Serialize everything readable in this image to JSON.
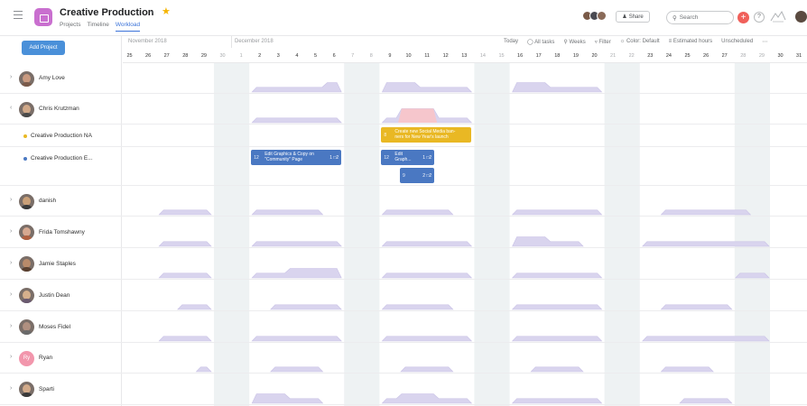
{
  "header": {
    "title": "Creative Production",
    "tabs": [
      {
        "label": "Projects",
        "active": false
      },
      {
        "label": "Timeline",
        "active": false
      },
      {
        "label": "Workload",
        "active": true
      }
    ],
    "share_label": "Share",
    "search_placeholder": "Search",
    "plus_label": "+",
    "help_label": "?"
  },
  "left": {
    "add_project_label": "Add Project"
  },
  "timeline": {
    "months": [
      "November 2018",
      "December 2018"
    ],
    "toolbar": [
      "Today",
      "All tasks",
      "Weeks",
      "Filter",
      "Color: Default",
      "Estimated hours",
      "Unscheduled",
      "⋯"
    ],
    "days": [
      "25",
      "26",
      "27",
      "28",
      "29",
      "30",
      "1",
      "2",
      "3",
      "4",
      "5",
      "6",
      "7",
      "8",
      "9",
      "10",
      "11",
      "12",
      "13",
      "14",
      "15",
      "16",
      "17",
      "18",
      "19",
      "20",
      "21",
      "22",
      "23",
      "24",
      "25",
      "26",
      "27",
      "28",
      "29",
      "30",
      "31"
    ],
    "weekend_indices": [
      5,
      6,
      12,
      13,
      19,
      20,
      26,
      27,
      33,
      34
    ]
  },
  "rows": [
    {
      "name": "Amy Love",
      "expander": "›",
      "type": "person",
      "skin": "#c99a80",
      "shirt": "#7a5a4a",
      "load": [
        0,
        0,
        0,
        0,
        0,
        0,
        0,
        1,
        1,
        1,
        1,
        2,
        0,
        0,
        2,
        2,
        1,
        1,
        1,
        0,
        0,
        2,
        2,
        1,
        1,
        1,
        0,
        0,
        0,
        0,
        0,
        0,
        0,
        0,
        0,
        0,
        0
      ]
    },
    {
      "name": "Chris Krutzman",
      "expander": "‹",
      "type": "person",
      "skin": "#d0a888",
      "shirt": "#4a4a4a",
      "load": [
        0,
        0,
        0,
        0,
        0,
        0,
        0,
        1,
        1,
        1,
        1,
        1,
        0,
        0,
        1,
        3,
        3,
        1,
        1,
        0,
        0,
        0,
        0,
        0,
        0,
        0,
        0,
        0,
        0,
        0,
        0,
        0,
        0,
        0,
        0,
        0,
        0
      ],
      "over": [
        15,
        16
      ]
    },
    {
      "name": "Creative Production NA",
      "type": "project",
      "dot": "#e9b824"
    },
    {
      "name": "Creative Production E...",
      "type": "project",
      "dot": "#4a78c2"
    },
    {
      "name": "danish",
      "expander": "›",
      "type": "person",
      "skin": "#caa078",
      "shirt": "#3a3a3a",
      "load": [
        0,
        0,
        1,
        1,
        1,
        0,
        0,
        1,
        1,
        1,
        1,
        0,
        0,
        0,
        1,
        1,
        1,
        1,
        0,
        0,
        0,
        1,
        1,
        1,
        1,
        1,
        0,
        0,
        0,
        1,
        1,
        1,
        1,
        1,
        0,
        0,
        0
      ]
    },
    {
      "name": "Frida Tomshawny",
      "expander": "›",
      "type": "person",
      "skin": "#d6a890",
      "shirt": "#b06040",
      "load": [
        0,
        0,
        1,
        1,
        1,
        0,
        0,
        1,
        1,
        1,
        1,
        1,
        0,
        0,
        1,
        1,
        1,
        1,
        1,
        0,
        0,
        2,
        2,
        1,
        1,
        0,
        0,
        0,
        1,
        1,
        1,
        1,
        1,
        1,
        1,
        0,
        0
      ]
    },
    {
      "name": "Jamie Staples",
      "expander": "›",
      "type": "person",
      "skin": "#b88a6a",
      "shirt": "#5a4030",
      "load": [
        0,
        0,
        1,
        1,
        1,
        0,
        0,
        1,
        1,
        2,
        2,
        2,
        0,
        0,
        1,
        1,
        1,
        1,
        1,
        0,
        0,
        1,
        1,
        1,
        1,
        1,
        0,
        0,
        0,
        0,
        0,
        0,
        0,
        1,
        1,
        0,
        0
      ]
    },
    {
      "name": "Justin Dean",
      "expander": "›",
      "type": "person",
      "skin": "#d6b08c",
      "shirt": "#6a5a70",
      "load": [
        0,
        0,
        0,
        1,
        1,
        0,
        0,
        0,
        1,
        1,
        1,
        1,
        0,
        0,
        1,
        1,
        1,
        1,
        0,
        0,
        0,
        1,
        1,
        1,
        1,
        1,
        0,
        0,
        0,
        1,
        1,
        1,
        1,
        0,
        0,
        0,
        0
      ]
    },
    {
      "name": "Moses Fidel",
      "expander": "›",
      "type": "person",
      "skin": "#b09080",
      "shirt": "#6a6a6a",
      "load": [
        0,
        0,
        1,
        1,
        1,
        0,
        0,
        1,
        1,
        1,
        1,
        1,
        0,
        0,
        1,
        1,
        1,
        1,
        1,
        0,
        0,
        1,
        1,
        1,
        1,
        1,
        0,
        0,
        1,
        1,
        1,
        1,
        1,
        1,
        1,
        0,
        0
      ]
    },
    {
      "name": "Ryan",
      "expander": "›",
      "type": "initials",
      "initials": "Ry",
      "load": [
        0,
        0,
        0,
        0,
        1,
        0,
        0,
        0,
        1,
        1,
        1,
        0,
        0,
        0,
        0,
        1,
        1,
        1,
        0,
        0,
        0,
        0,
        1,
        1,
        1,
        0,
        0,
        0,
        0,
        1,
        1,
        1,
        0,
        0,
        0,
        0,
        0
      ]
    },
    {
      "name": "Sparti",
      "expander": "›",
      "type": "person",
      "skin": "#d2aa8a",
      "shirt": "#3a3a3a",
      "load": [
        0,
        0,
        0,
        0,
        0,
        0,
        0,
        2,
        2,
        1,
        1,
        0,
        0,
        0,
        1,
        2,
        2,
        1,
        1,
        0,
        0,
        1,
        1,
        1,
        1,
        1,
        0,
        0,
        0,
        0,
        1,
        1,
        1,
        0,
        0,
        0,
        0
      ]
    }
  ],
  "tasks": [
    {
      "num": "12",
      "title": "Edit Graphics & Copy on \"Community\" Page",
      "count": "1 □2",
      "color": "#4a78c2",
      "row": 3,
      "start": 7,
      "span": 5,
      "line": 0,
      "title_lines": [
        "Edit Graphics & Copy on",
        "\"Community\" Page"
      ]
    },
    {
      "num": "12",
      "title": "Edit Graph...",
      "count": "1 □2",
      "color": "#4a78c2",
      "row": 3,
      "start": 14,
      "span": 3,
      "line": 0,
      "title_lines": [
        "Edit",
        "Graph..."
      ]
    },
    {
      "num": "9",
      "title": "",
      "count": "2 □2",
      "color": "#4a78c2",
      "row": 3,
      "start": 15,
      "span": 2,
      "line": 1,
      "title_lines": [
        "",
        ""
      ]
    },
    {
      "num": "8",
      "title": "Create new Social Media banners for New Year's launch",
      "count": "",
      "color": "#e9b824",
      "row": 2,
      "start": 14,
      "span": 5,
      "line": 0,
      "title_lines": [
        "Create new Social Media ban-",
        "ners for New Year's launch"
      ]
    }
  ],
  "colors": {
    "load": "#d9d4ee",
    "load_stroke": "#c9c2e6",
    "overload": "#f6c6cc",
    "weekend": "#eef2f3"
  }
}
